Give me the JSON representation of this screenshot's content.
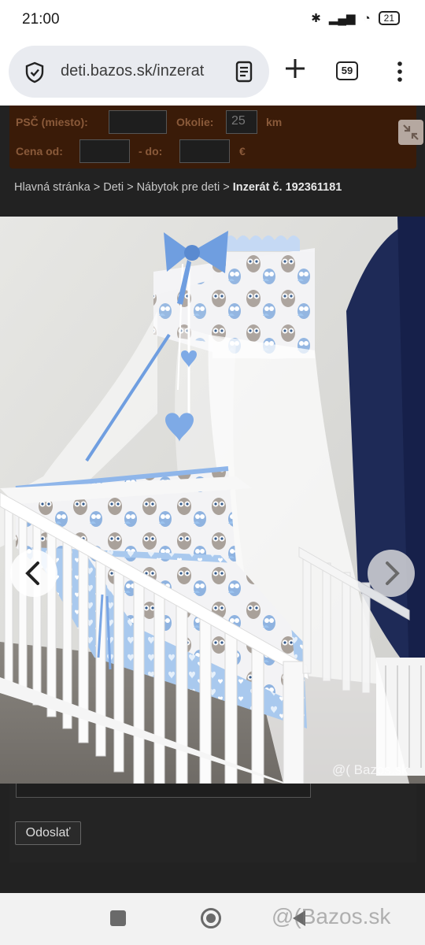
{
  "status": {
    "time": "21:00",
    "battery": "21"
  },
  "browser": {
    "url": "deti.bazos.sk/inzerat",
    "tab_count": "59"
  },
  "filter": {
    "psc_label": "PSČ (miesto):",
    "okolie_label": "Okolie:",
    "okolie_value": "25",
    "km_label": "km",
    "cena_label": "Cena od:",
    "do_label": "- do:",
    "currency": "€"
  },
  "breadcrumb": {
    "home": "Hlavná stránka",
    "sep": " > ",
    "cat": "Deti",
    "sub": "Nábytok pre deti",
    "current": "Inzerát č. 192361181"
  },
  "photo": {
    "watermark": "@( Bazos.sk"
  },
  "form": {
    "submit_label": "Odoslať"
  },
  "navbar": {
    "watermark": "@(Bazos.sk"
  }
}
